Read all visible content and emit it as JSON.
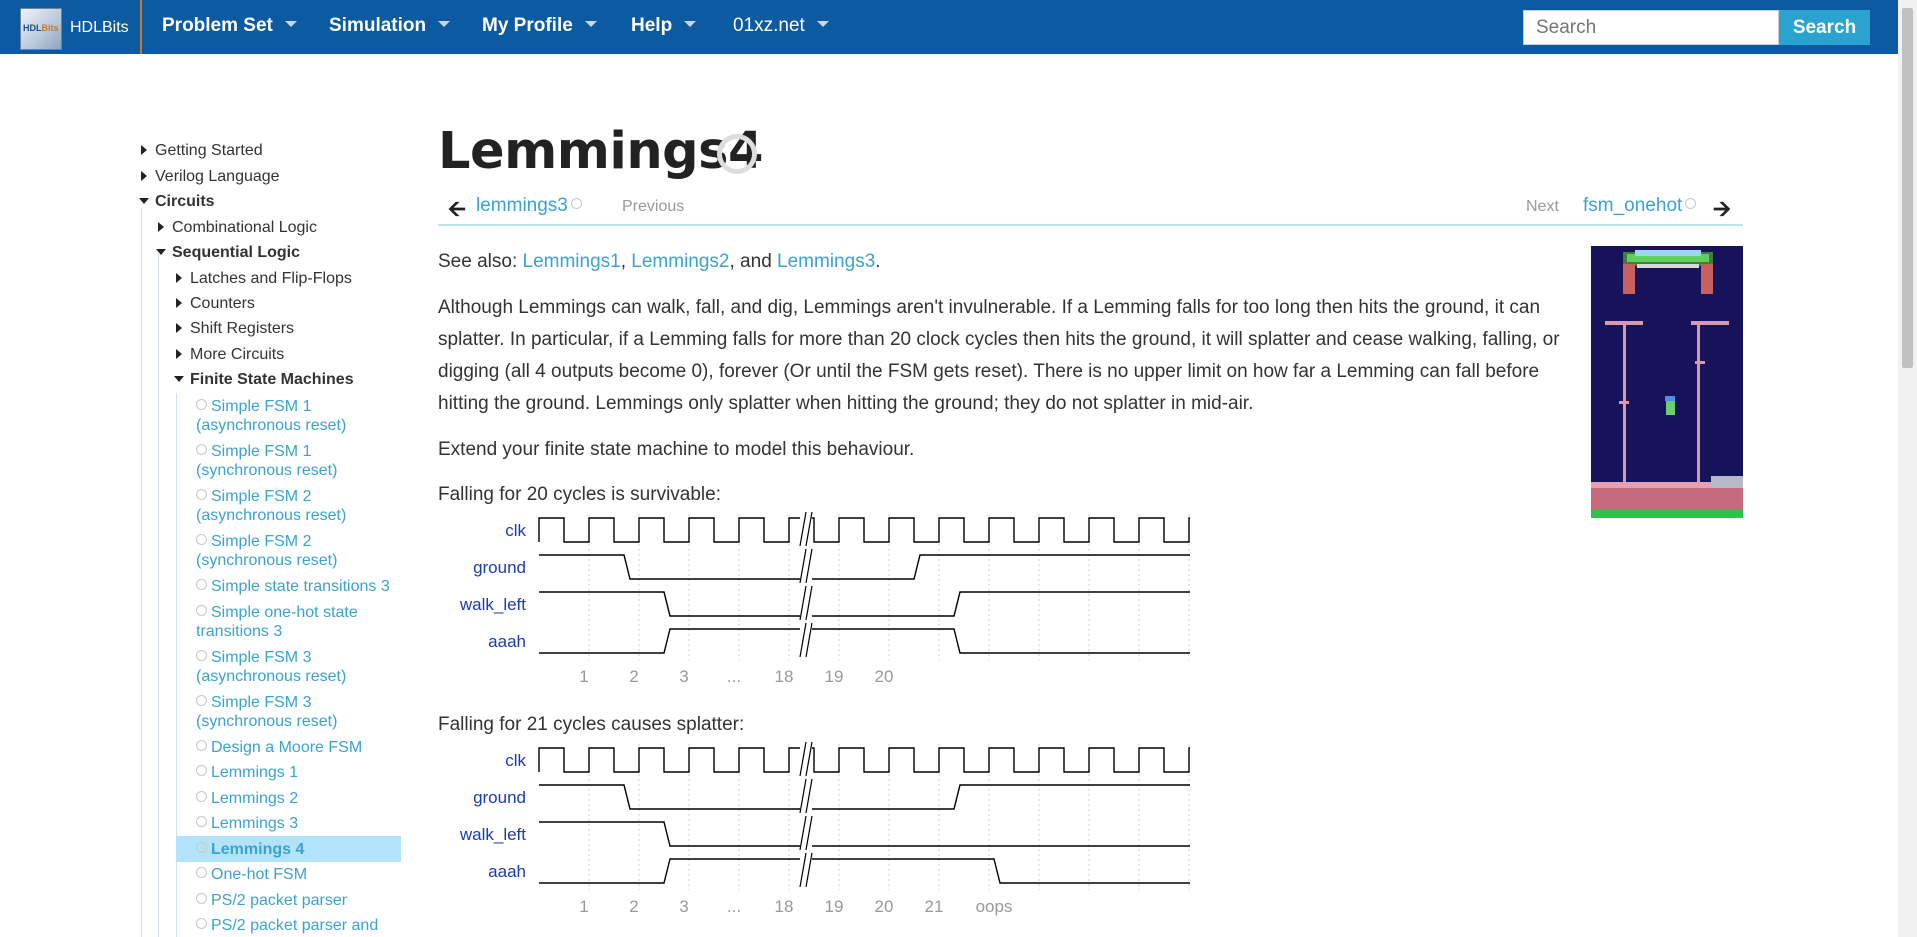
{
  "navbar": {
    "brand": "HDLBits",
    "logo_text_a": "HDL",
    "logo_text_b": "Bits",
    "items": [
      "Problem Set",
      "Simulation",
      "My Profile",
      "Help",
      "01xz.net"
    ],
    "search_placeholder": "Search",
    "search_button": "Search"
  },
  "sidebar": {
    "top": [
      "Getting Started",
      "Verilog Language"
    ],
    "circuits": "Circuits",
    "combinational": "Combinational Logic",
    "sequential": "Sequential Logic",
    "seq_children": [
      "Latches and Flip-Flops",
      "Counters",
      "Shift Registers",
      "More Circuits"
    ],
    "fsm": "Finite State Machines",
    "fsm_items": [
      [
        "Simple FSM 1",
        "(asynchronous reset)"
      ],
      [
        "Simple FSM 1",
        "(synchronous reset)"
      ],
      [
        "Simple FSM 2",
        "(asynchronous reset)"
      ],
      [
        "Simple FSM 2",
        "(synchronous reset)"
      ],
      [
        "Simple state transitions 3"
      ],
      [
        "Simple one-hot state",
        "transitions 3"
      ],
      [
        "Simple FSM 3",
        "(asynchronous reset)"
      ],
      [
        "Simple FSM 3",
        "(synchronous reset)"
      ],
      [
        "Design a Moore FSM"
      ],
      [
        "Lemmings 1"
      ],
      [
        "Lemmings 2"
      ],
      [
        "Lemmings 3"
      ],
      [
        "Lemmings 4"
      ],
      [
        "One-hot FSM"
      ],
      [
        "PS/2 packet parser"
      ],
      [
        "PS/2 packet parser and"
      ]
    ],
    "active_index": 12
  },
  "page": {
    "title": "Lemmings4",
    "prev_link": "lemmings3",
    "prev_label": "Previous",
    "next_label": "Next",
    "next_link": "fsm_onehot",
    "see_also_prefix": "See also: ",
    "see_also_links": [
      "Lemmings1",
      "Lemmings2",
      "Lemmings3"
    ],
    "see_also_sep1": ", ",
    "see_also_sep2": ", and ",
    "see_also_end": ".",
    "paragraph1": "Although Lemmings can walk, fall, and dig, Lemmings aren't invulnerable. If a Lemming falls for too long then hits the ground, it can splatter. In particular, if a Lemming falls for more than 20 clock cycles then hits the ground, it will splatter and cease walking, falling, or digging (all 4 outputs become 0), forever (Or until the FSM gets reset). There is no upper limit on how far a Lemming can fall before hitting the ground. Lemmings only splatter when hitting the ground; they do not splatter in mid-air.",
    "paragraph2": "Extend your finite state machine to model this behaviour."
  },
  "waveforms": [
    {
      "caption": "Falling for 20 cycles is survivable:",
      "signals": [
        "clk",
        "ground",
        "walk_left",
        "aaah"
      ],
      "cycle_labels": [
        "1",
        "2",
        "3",
        "...",
        "18",
        "19",
        "20"
      ]
    },
    {
      "caption": "Falling for 21 cycles causes splatter:",
      "signals": [
        "clk",
        "ground",
        "walk_left",
        "aaah"
      ],
      "cycle_labels": [
        "1",
        "2",
        "3",
        "...",
        "18",
        "19",
        "20",
        "21",
        "oops"
      ]
    }
  ],
  "colors": {
    "navbar": "#0b5aa2",
    "link": "#3aa3cf",
    "signal_label": "#1a3cb0",
    "active_bg": "#b3e3f9"
  }
}
